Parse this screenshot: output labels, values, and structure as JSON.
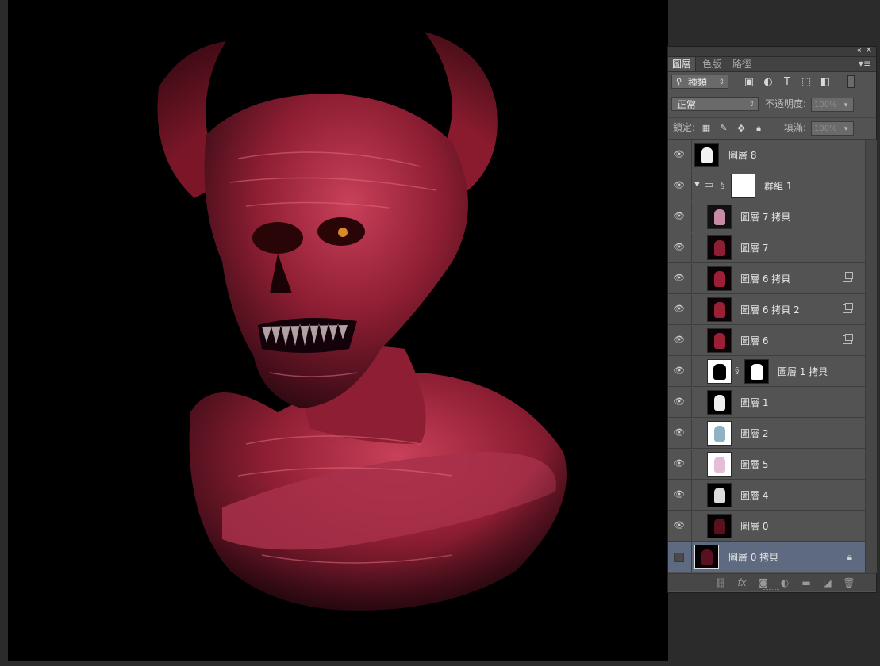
{
  "panel": {
    "collapse_icon": "double-chevron-left-icon",
    "close_icon": "close-icon",
    "menu_icon": "panel-menu-icon",
    "tabs": [
      {
        "label": "圖層",
        "active": true
      },
      {
        "label": "色版",
        "active": false
      },
      {
        "label": "路徑",
        "active": false
      }
    ],
    "filter": {
      "kind_label": "種類",
      "search_icon": "search-icon",
      "filter_icons": [
        "image-filter-icon",
        "adjustment-filter-icon",
        "type-filter-icon",
        "shape-filter-icon",
        "smart-object-filter-icon",
        "filter-toggle-icon"
      ]
    },
    "blend": {
      "mode": "正常",
      "opacity_label": "不透明度:",
      "opacity_value": "100%"
    },
    "lock": {
      "label": "鎖定:",
      "icons": [
        "lock-transparent-icon",
        "lock-paint-icon",
        "lock-move-icon",
        "lock-all-icon"
      ],
      "fill_label": "填滿:",
      "fill_value": "100%"
    },
    "layers": [
      {
        "name": "圖層 8",
        "visible": true,
        "indent": 0,
        "thumb": "white-figure"
      },
      {
        "name": "群組 1",
        "visible": true,
        "indent": 0,
        "group": true
      },
      {
        "name": "圖層 7 拷貝",
        "visible": true,
        "indent": 1,
        "thumb": "pink-figure"
      },
      {
        "name": "圖層 7",
        "visible": true,
        "indent": 1,
        "thumb": "red-figure"
      },
      {
        "name": "圖層 6 拷貝",
        "visible": true,
        "indent": 1,
        "thumb": "red-figure",
        "smart": true
      },
      {
        "name": "圖層 6 拷貝 2",
        "visible": true,
        "indent": 1,
        "thumb": "red-figure",
        "smart": true
      },
      {
        "name": "圖層 6",
        "visible": true,
        "indent": 1,
        "thumb": "red-figure",
        "smart": true
      },
      {
        "name": "圖層 1 拷貝",
        "visible": true,
        "indent": 1,
        "thumb": "black-on-white",
        "mask": true
      },
      {
        "name": "圖層 1",
        "visible": true,
        "indent": 1,
        "thumb": "white-figure"
      },
      {
        "name": "圖層 2",
        "visible": true,
        "indent": 1,
        "thumb": "blue-figure"
      },
      {
        "name": "圖層 5",
        "visible": true,
        "indent": 1,
        "thumb": "pink-figure-light"
      },
      {
        "name": "圖層 4",
        "visible": true,
        "indent": 1,
        "thumb": "white-figure"
      },
      {
        "name": "圖層 0",
        "visible": true,
        "indent": 1,
        "thumb": "dark-red-figure"
      },
      {
        "name": "圖層 0 拷貝",
        "visible": false,
        "indent": 0,
        "thumb": "dark-red-figure",
        "locked": true,
        "selected": true
      }
    ],
    "bottom_icons": [
      "link-layers-icon",
      "fx-icon",
      "add-mask-icon",
      "adjustment-layer-icon",
      "new-group-icon",
      "new-layer-icon",
      "trash-icon"
    ]
  },
  "colors": {
    "canvas_bg": "#000000",
    "panel_bg": "#535353",
    "selected_row": "#5d6a80",
    "demon_red": "#b3263f"
  }
}
